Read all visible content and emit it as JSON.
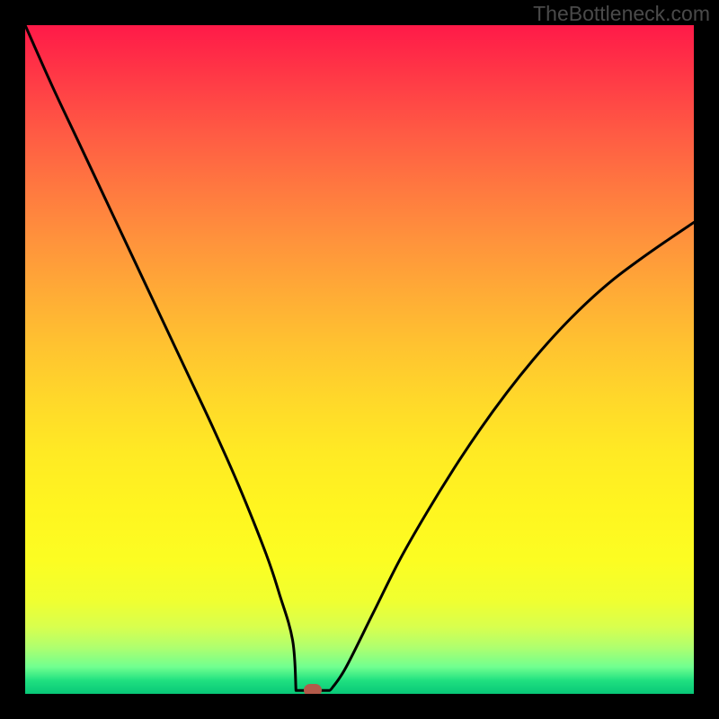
{
  "watermark": "TheBottleneck.com",
  "colors": {
    "frame": "#000000",
    "curve": "#000000",
    "marker": "#b35a4a",
    "gradient_top": "#ff1a48",
    "gradient_bottom": "#08c878"
  },
  "chart_data": {
    "type": "line",
    "title": "",
    "xlabel": "",
    "ylabel": "",
    "xlim": [
      0,
      100
    ],
    "ylim": [
      0,
      100
    ],
    "x": [
      0,
      4,
      8,
      12,
      16,
      20,
      24,
      28,
      32,
      36,
      38,
      40,
      41,
      42,
      43,
      44,
      46,
      48,
      52,
      56,
      60,
      64,
      68,
      72,
      76,
      80,
      84,
      88,
      92,
      96,
      100
    ],
    "values": [
      100,
      91,
      82.5,
      74,
      65.5,
      57,
      48.5,
      40,
      31,
      21,
      15,
      8,
      4,
      1,
      0.5,
      0.5,
      1,
      4,
      12,
      20,
      27,
      33.5,
      39.5,
      45,
      50,
      54.5,
      58.5,
      62,
      65,
      67.8,
      70.5
    ],
    "marker": {
      "x": 43,
      "y": 0.5
    },
    "flat_segment": {
      "x_start": 40.5,
      "x_end": 45.5,
      "y": 0.5
    },
    "annotations": []
  }
}
